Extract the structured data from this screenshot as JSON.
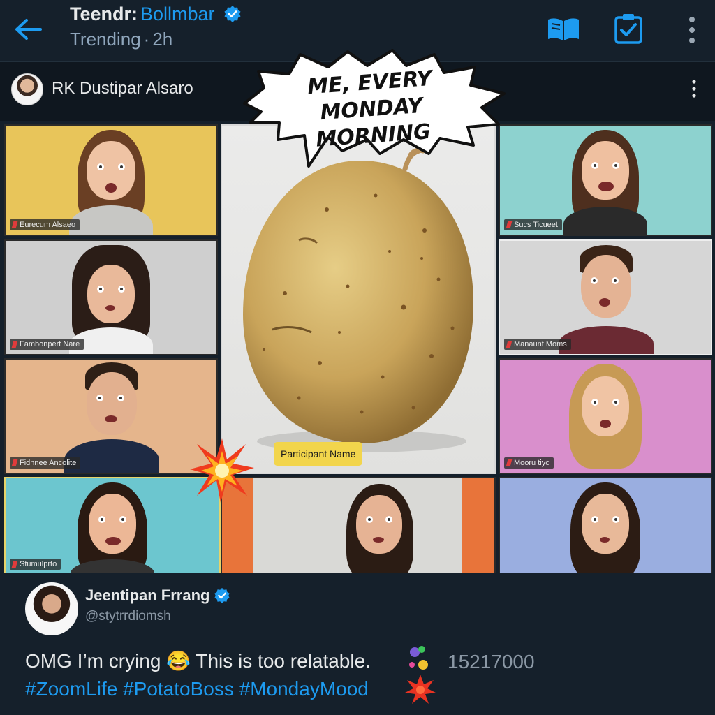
{
  "header": {
    "app_title": "Teendr:",
    "account_name": "Bollmbar",
    "subtitle": "Trending",
    "time": "2h"
  },
  "post": {
    "author": "RK Dustipar Alsaro",
    "speech_bubble_line1": "ME, EVERY",
    "speech_bubble_line2": "MONDAY MORNING",
    "center_tile_name": "Participant Name"
  },
  "tiles": [
    {
      "name": "Eurecum Alsaeo",
      "bg": "#e8c55a"
    },
    {
      "name": "Fambonpert Nare",
      "bg": "#cfcfcf"
    },
    {
      "name": "Fidnnee Ancolite",
      "bg": "#e5b58c"
    },
    {
      "name": "Stumulprto",
      "bg": "#6cc6cf"
    },
    {
      "name": "",
      "bg": "#e8743a"
    },
    {
      "name": "Sucs Ticueet",
      "bg": "#8dd2cf"
    },
    {
      "name": "Manaunt Moms",
      "bg": "#d6d6d6"
    },
    {
      "name": "Mooru tiyc",
      "bg": "#d98fcc"
    },
    {
      "name": "",
      "bg": "#9aaee0"
    }
  ],
  "comment": {
    "name": "Jeentipan Frrang",
    "handle": "@stytrrdiomsh",
    "text": "OMG I’m crying 😂 This is too relatable.",
    "count": "15217000",
    "hashtags": [
      "#ZoomLife",
      "#PotatoBoss",
      "#MondayMood"
    ]
  },
  "colors": {
    "background": "#15202b",
    "accent": "#1d9bf0",
    "name_tag_yellow": "#f2d54c"
  },
  "icons": [
    "back-arrow-icon",
    "verified-icon",
    "book-icon",
    "clipboard-check-icon",
    "more-vertical-icon",
    "burst-icon"
  ]
}
